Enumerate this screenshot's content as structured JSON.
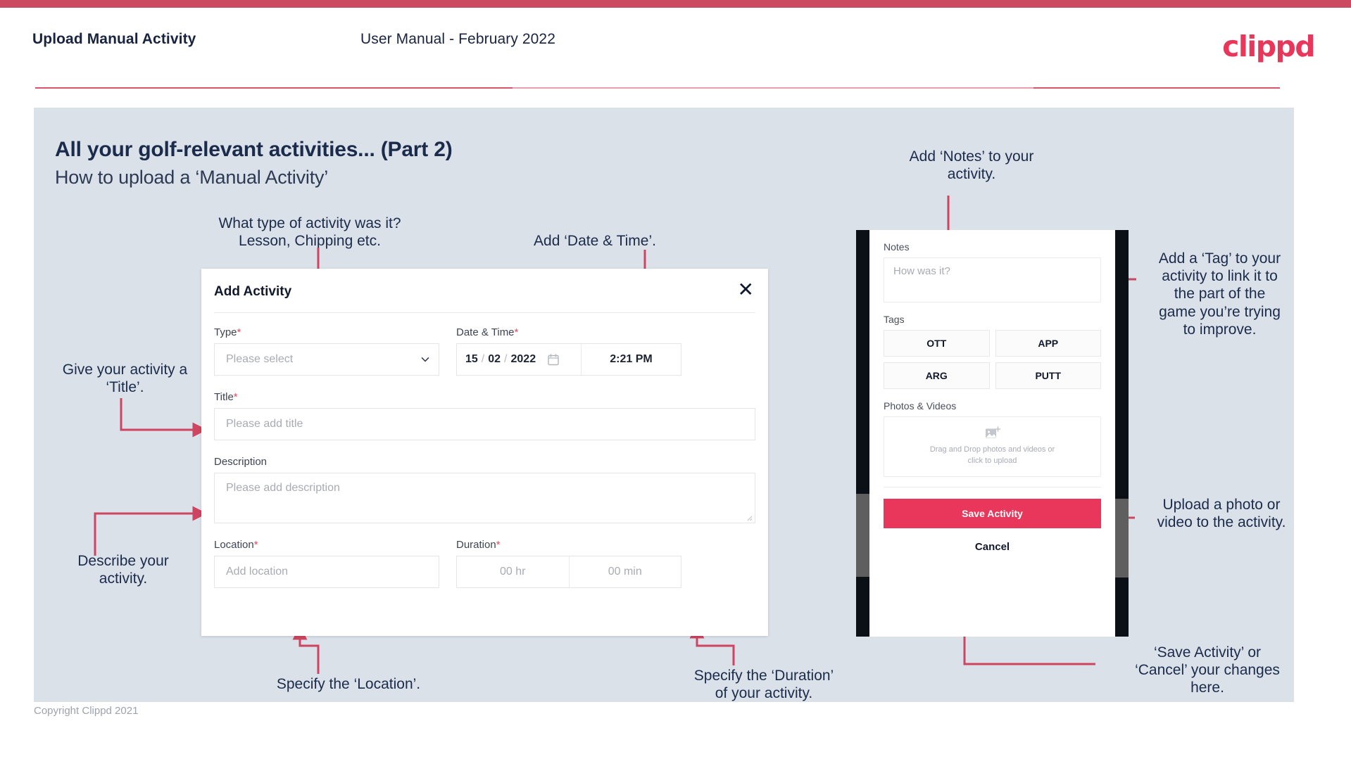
{
  "header": {
    "title": "Upload Manual Activity",
    "subtitle": "User Manual - February 2022",
    "logo": "clippd"
  },
  "slide": {
    "title": "All your golf-relevant activities... (Part 2)",
    "subtitle": "How to upload a ‘Manual Activity’"
  },
  "annotations": {
    "type": "What type of activity was it?\nLesson, Chipping etc.",
    "datetime": "Add ‘Date & Time’.",
    "title": "Give your activity a\n‘Title’.",
    "description": "Describe your\nactivity.",
    "location": "Specify the ‘Location’.",
    "duration": "Specify the ‘Duration’\nof your activity.",
    "notes": "Add ‘Notes’ to your\nactivity.",
    "tags": "Add a ‘Tag’ to your\nactivity to link it to\nthe part of the\ngame you’re trying\nto improve.",
    "photos": "Upload a photo or\nvideo to the activity.",
    "save": "‘Save Activity’ or\n‘Cancel’ your changes\nhere."
  },
  "dialog": {
    "title": "Add Activity",
    "close_icon": "close-icon",
    "fields": {
      "type": {
        "label": "Type",
        "required": "*",
        "placeholder": "Please select",
        "chevron": "chevron-down-icon"
      },
      "datetime": {
        "label": "Date & Time",
        "required": "*",
        "day": "15",
        "month": "02",
        "year": "2022",
        "sep1": "/",
        "sep2": "/",
        "calendar_icon": "calendar-icon",
        "time": "2:21 PM"
      },
      "title": {
        "label": "Title",
        "required": "*",
        "placeholder": "Please add title"
      },
      "description": {
        "label": "Description",
        "required": "",
        "placeholder": "Please add description"
      },
      "location": {
        "label": "Location",
        "required": "*",
        "placeholder": "Add location"
      },
      "duration": {
        "label": "Duration",
        "required": "*",
        "hours": "00 hr",
        "minutes": "00 min"
      }
    }
  },
  "phone": {
    "notes_label": "Notes",
    "notes_placeholder": "How was it?",
    "tags_label": "Tags",
    "tags": [
      "OTT",
      "APP",
      "ARG",
      "PUTT"
    ],
    "photos_label": "Photos & Videos",
    "dropzone_line1": "Drag and Drop photos and videos or",
    "dropzone_line2": "click to upload",
    "dropzone_icon": "add-image-icon",
    "save_label": "Save Activity",
    "cancel_label": "Cancel"
  },
  "footer": {
    "copyright": "Copyright Clippd 2021"
  },
  "colors": {
    "accent": "#e8375b",
    "top_strip": "#cb4a5f",
    "arrow": "#cd4560",
    "slide_bg": "#dbe1e9",
    "text_dark": "#1b2b4b"
  }
}
